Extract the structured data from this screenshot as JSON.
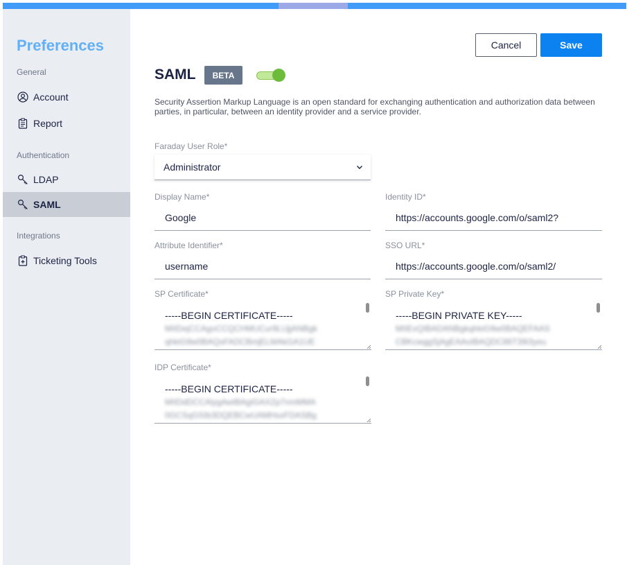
{
  "sidebar": {
    "title": "Preferences",
    "sections": {
      "general": "General",
      "authentication": "Authentication",
      "integrations": "Integrations"
    },
    "items": {
      "account": "Account",
      "report": "Report",
      "ldap": "LDAP",
      "saml": "SAML",
      "ticketing": "Ticketing Tools"
    }
  },
  "header": {
    "cancel_label": "Cancel",
    "save_label": "Save"
  },
  "saml": {
    "title": "SAML",
    "badge": "BETA",
    "enabled": true,
    "description": "Security Assertion Markup Language is an open standard for exchanging authentication and authorization data between parties, in particular, between an identity provider and a service provider."
  },
  "form": {
    "user_role": {
      "label": "Faraday User Role*",
      "value": "Administrator"
    },
    "display_name": {
      "label": "Display Name*",
      "value": "Google"
    },
    "identity_id": {
      "label": "Identity ID*",
      "value": "https://accounts.google.com/o/saml2?"
    },
    "attribute_identifier": {
      "label": "Attribute Identifier*",
      "value": "username"
    },
    "sso_url": {
      "label": "SSO URL*",
      "value": "https://accounts.google.com/o/saml2/"
    },
    "sp_certificate": {
      "label": "SP Certificate*",
      "first_line": "-----BEGIN CERTIFICATE-----",
      "blurred_1": "MIIDejCCAgoCCQCHMUCur9LUjjANBgk",
      "blurred_2": "qhkiG9w0BAQsFADCBmjELMAkGA1UE"
    },
    "sp_private_key": {
      "label": "SP Private Key*",
      "first_line": "-----BEGIN PRIVATE KEY-----",
      "blurred_1": "MIIEvQIBADANBgkqhkiG9w0BAQEFAAS",
      "blurred_2": "CBKcwggSjAgEAAoIBAQDC86T39i3yeu"
    },
    "idp_certificate": {
      "label": "IDP Certificate*",
      "first_line": "-----BEGIN CERTIFICATE-----",
      "blurred_1": "MIIDdDCCAlygAwIBAgIGAXZp7nmMMA",
      "blurred_2": "0GCSqGSIb3DQEBCwUAMHsxFDASBg"
    }
  },
  "colors": {
    "accent": "#0b82f0",
    "sidebar_title": "#62b0f6",
    "toggle_on": "#6dbb3b",
    "badge_bg": "#67768a"
  }
}
